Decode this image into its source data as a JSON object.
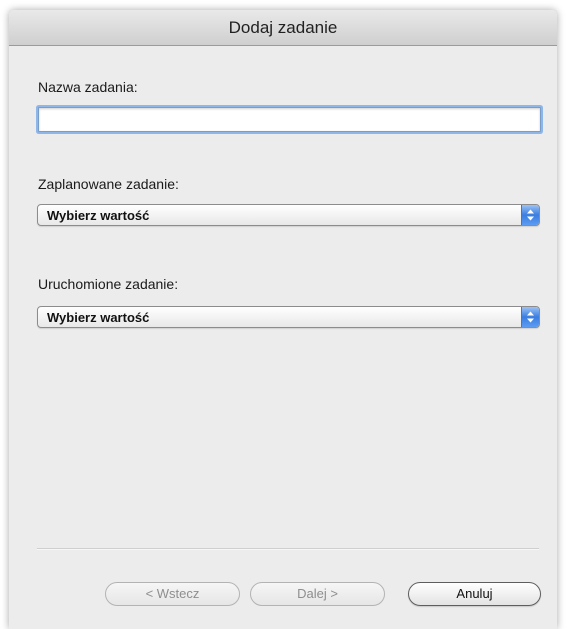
{
  "window": {
    "title": "Dodaj zadanie"
  },
  "form": {
    "task_name_label": "Nazwa zadania:",
    "task_name_value": "",
    "scheduled_task_label": "Zaplanowane zadanie:",
    "scheduled_task_value": "Wybierz wartość",
    "running_task_label": "Uruchomione zadanie:",
    "running_task_value": "Wybierz wartość"
  },
  "buttons": {
    "back_label": "< Wstecz",
    "next_label": "Dalej >",
    "cancel_label": "Anuluj",
    "back_enabled": false,
    "next_enabled": false,
    "cancel_enabled": true
  },
  "colors": {
    "focus_ring": "#8fb6e8",
    "popup_arrow_accent": "#3a7ee0"
  },
  "icons": {
    "popup_arrows": "up-down-chevron-icon"
  }
}
